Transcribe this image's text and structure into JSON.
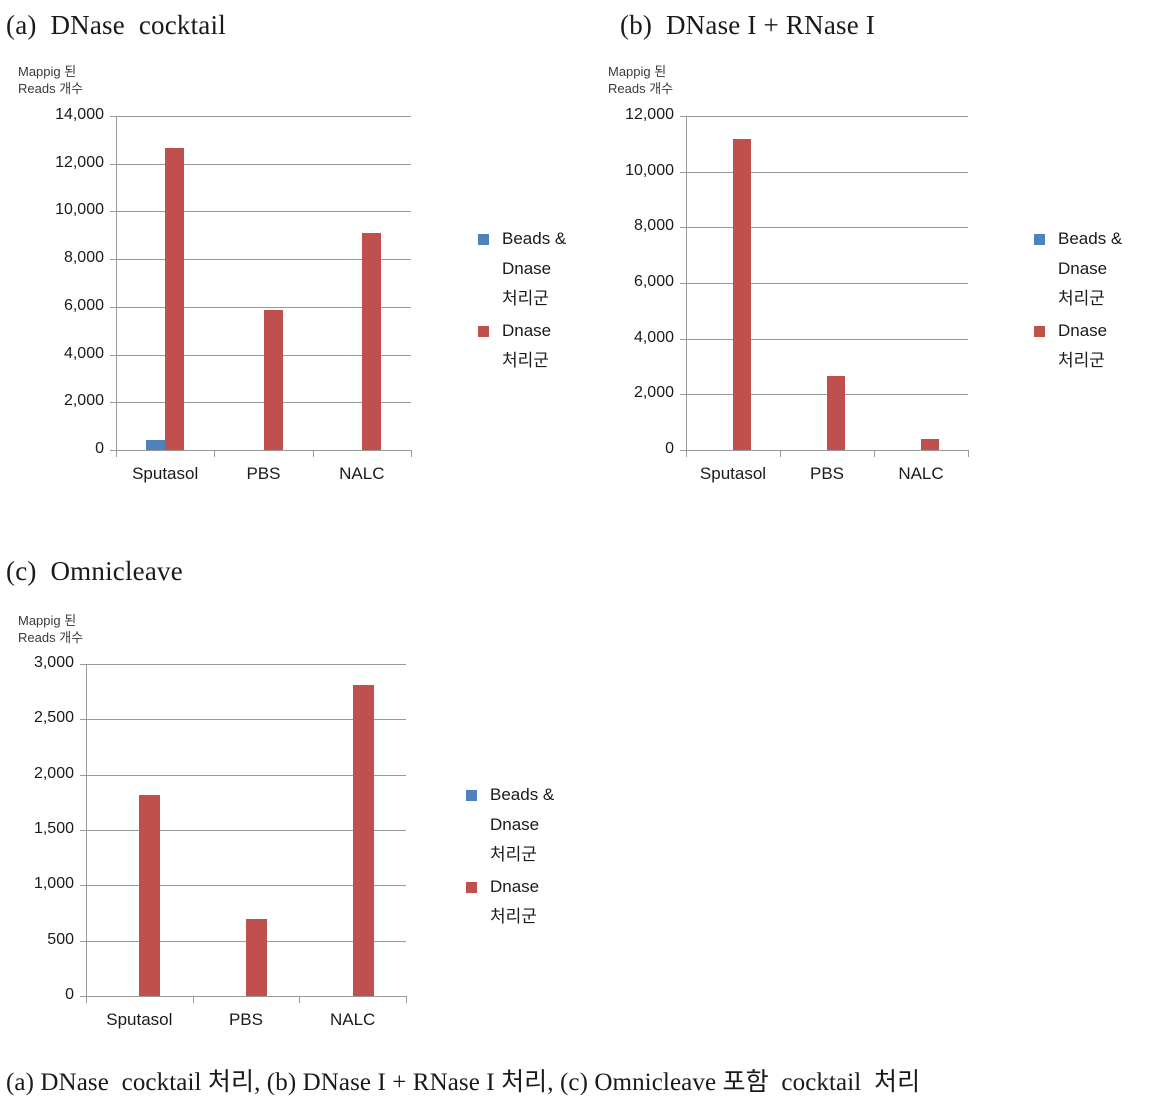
{
  "figure": {
    "caption": "(a) DNase  cocktail 처리, (b) DNase I + RNase I 처리, (c) Omnicleave 포함  cocktail  처리"
  },
  "colors": {
    "series_beads_dnase": "#4F81BD",
    "series_dnase": "#C0504D",
    "gridline": "#9a9a9a",
    "text": "#1a1a1a"
  },
  "legend": {
    "entries": [
      {
        "swatch_color": "#4F81BD",
        "line1": "Beads &",
        "line2": "Dnase",
        "line3": "처리군"
      },
      {
        "swatch_color": "#C0504D",
        "line1": "Dnase",
        "line2": "처리군",
        "line3": ""
      }
    ]
  },
  "panels": [
    {
      "title": "(a)  DNase  cocktail",
      "axis_caption_line1": "Mappig 된",
      "axis_caption_line2": "Reads 개수",
      "chart_data": {
        "type": "bar",
        "title": "(a)  DNase  cocktail",
        "xlabel": "",
        "ylabel": "Mappig 된 Reads 개수",
        "categories": [
          "Sputasol",
          "PBS",
          "NALC"
        ],
        "series": [
          {
            "name": "Beads & Dnase 처리군",
            "color": "#4F81BD",
            "values": [
              400,
              0,
              0
            ]
          },
          {
            "name": "Dnase 처리군",
            "color": "#C0504D",
            "values": [
              12650,
              5870,
              9080
            ]
          }
        ],
        "ylim": [
          0,
          14000
        ],
        "yticks": [
          0,
          2000,
          4000,
          6000,
          8000,
          10000,
          12000,
          14000
        ],
        "ytick_labels": [
          "0",
          "2,000",
          "4,000",
          "6,000",
          "8,000",
          "10,000",
          "12,000",
          "14,000"
        ],
        "grid": true,
        "legend_position": "right"
      }
    },
    {
      "title": "(b)  DNase I + RNase I",
      "axis_caption_line1": "Mappig 된",
      "axis_caption_line2": "Reads 개수",
      "chart_data": {
        "type": "bar",
        "title": "(b)  DNase I + RNase I",
        "xlabel": "",
        "ylabel": "Mappig 된 Reads 개수",
        "categories": [
          "Sputasol",
          "PBS",
          "NALC"
        ],
        "series": [
          {
            "name": "Beads & Dnase 처리군",
            "color": "#4F81BD",
            "values": [
              0,
              0,
              0
            ]
          },
          {
            "name": "Dnase 처리군",
            "color": "#C0504D",
            "values": [
              11180,
              2650,
              400
            ]
          }
        ],
        "ylim": [
          0,
          12000
        ],
        "yticks": [
          0,
          2000,
          4000,
          6000,
          8000,
          10000,
          12000
        ],
        "ytick_labels": [
          "0",
          "2,000",
          "4,000",
          "6,000",
          "8,000",
          "10,000",
          "12,000"
        ],
        "grid": true,
        "legend_position": "right"
      }
    },
    {
      "title": "(c)  Omnicleave",
      "axis_caption_line1": "Mappig 된",
      "axis_caption_line2": "Reads 개수",
      "chart_data": {
        "type": "bar",
        "title": "(c)  Omnicleave",
        "xlabel": "",
        "ylabel": "Mappig 된 Reads 개수",
        "categories": [
          "Sputasol",
          "PBS",
          "NALC"
        ],
        "series": [
          {
            "name": "Beads & Dnase 처리군",
            "color": "#4F81BD",
            "values": [
              0,
              0,
              0
            ]
          },
          {
            "name": "Dnase 처리군",
            "color": "#C0504D",
            "values": [
              1820,
              700,
              2810
            ]
          }
        ],
        "ylim": [
          0,
          3000
        ],
        "yticks": [
          0,
          500,
          1000,
          1500,
          2000,
          2500,
          3000
        ],
        "ytick_labels": [
          "0",
          "500",
          "1,000",
          "1,500",
          "2,000",
          "2,500",
          "3,000"
        ],
        "grid": true,
        "legend_position": "right"
      }
    }
  ]
}
